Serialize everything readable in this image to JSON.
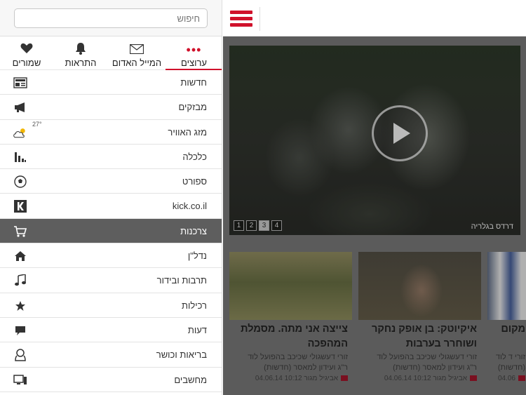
{
  "search": {
    "placeholder": "חיפוש"
  },
  "tabs": [
    {
      "label": "ערוצים",
      "icon": "more-dots-icon"
    },
    {
      "label": "המייל האדום",
      "icon": "mail-icon"
    },
    {
      "label": "התראות",
      "icon": "bell-icon"
    },
    {
      "label": "שמורים",
      "icon": "heart-icon"
    }
  ],
  "menu": [
    {
      "label": "חדשות",
      "icon": "newspaper-icon"
    },
    {
      "label": "מבזקים",
      "icon": "megaphone-icon"
    },
    {
      "label": "מזג האוויר",
      "icon": "weather-icon",
      "temp": "27°"
    },
    {
      "label": "כלכלה",
      "icon": "bar-chart-icon"
    },
    {
      "label": "ספורט",
      "icon": "soccer-ball-icon"
    },
    {
      "label": "kick.co.il",
      "icon": "kick-logo-icon"
    },
    {
      "label": "צרכנות",
      "icon": "shopping-cart-icon"
    },
    {
      "label": "נדל\"ן",
      "icon": "home-icon"
    },
    {
      "label": "תרבות ובידור",
      "icon": "music-note-icon"
    },
    {
      "label": "רכילות",
      "icon": "star-icon"
    },
    {
      "label": "דעות",
      "icon": "speech-bubble-icon"
    },
    {
      "label": "בריאות וכושר",
      "icon": "person-icon"
    },
    {
      "label": "מחשבים",
      "icon": "computer-icon"
    }
  ],
  "active_menu_index": 6,
  "hero": {
    "caption": "דרדס בגלריה",
    "pages": [
      "1",
      "2",
      "3",
      "4"
    ],
    "active_page": "3"
  },
  "cards": [
    {
      "title": "צייצה אני מתה. מסמלת המהפכה",
      "desc": "זורי דעשגולי שכיכב בהפועל לוד ר\"ג ועידון למאסר (חדשות)",
      "meta": "אביגיל מגור 10:12 04.06.14"
    },
    {
      "title": "איקיוטק: בן אופק נחקר ושוחרר בערבות",
      "desc": "זורי דעשגולי שכיכב בהפועל לוד ר\"ג ועידון למאסר (חדשות)",
      "meta": "אביגיל מגור 10:12 04.06.14"
    },
    {
      "title": "מקום",
      "desc": "זורי ד לוד (חדשות)",
      "meta": "04.06"
    }
  ],
  "colors": {
    "accent": "#d0112b",
    "active_row": "#5e5e5e"
  }
}
